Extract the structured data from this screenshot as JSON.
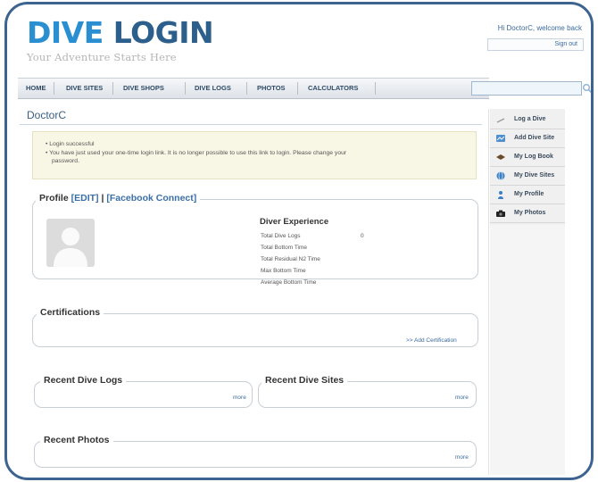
{
  "header": {
    "logo_word1": "DIVE",
    "logo_word2": "LOGIN",
    "tagline": "Your Adventure Starts Here",
    "welcome": "Hi DoctorC, welcome back",
    "signout": "Sign out"
  },
  "nav": {
    "items": [
      {
        "label": "HOME"
      },
      {
        "label": "DIVE SITES"
      },
      {
        "label": "DIVE SHOPS"
      },
      {
        "label": "DIVE LOGS"
      },
      {
        "label": "PHOTOS"
      },
      {
        "label": "CALCULATORS"
      }
    ],
    "search_value": ""
  },
  "user": {
    "name": "DoctorC"
  },
  "messages": [
    "Login successful",
    "You have just used your one-time login link. It is no longer possible to use this link to login. Please change your",
    "password."
  ],
  "profile": {
    "legend_title": "Profile",
    "edit": "[EDIT]",
    "sep": "|",
    "facebook": "[Facebook Connect]",
    "experience_title": "Diver Experience",
    "rows": [
      {
        "label": "Total Dive Logs",
        "value": "0"
      },
      {
        "label": "Total Bottom Time",
        "value": ""
      },
      {
        "label": "Total Residual N2 Time",
        "value": ""
      },
      {
        "label": "Max Bottom Time",
        "value": ""
      },
      {
        "label": "Average Bottom Time",
        "value": ""
      }
    ]
  },
  "certifications": {
    "title": "Certifications",
    "add_link": ">> Add Certification"
  },
  "recent_logs": {
    "title": "Recent Dive Logs",
    "more": "more"
  },
  "recent_sites": {
    "title": "Recent Dive Sites",
    "more": "more"
  },
  "recent_photos": {
    "title": "Recent Photos",
    "more": "more"
  },
  "sidebar": {
    "items": [
      {
        "label": "Log a Dive",
        "icon": "pencil-icon"
      },
      {
        "label": "Add Dive Site",
        "icon": "map-icon"
      },
      {
        "label": "My Log Book",
        "icon": "book-icon"
      },
      {
        "label": "My Dive Sites",
        "icon": "globe-icon"
      },
      {
        "label": "My Profile",
        "icon": "person-icon"
      },
      {
        "label": "My Photos",
        "icon": "camera-icon"
      }
    ]
  },
  "colors": {
    "accent": "#2a8fd0",
    "brand_dark": "#2c5f8c",
    "link": "#3b6aa0",
    "message_bg": "#f8f6e4"
  }
}
